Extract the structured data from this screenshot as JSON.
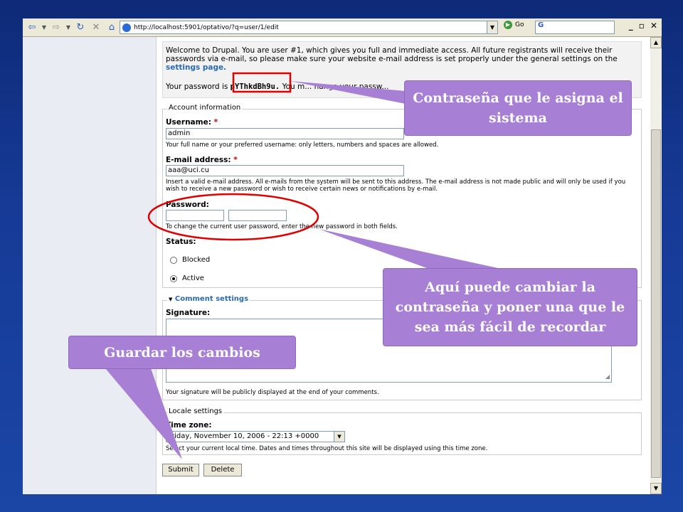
{
  "browser": {
    "address": "http://localhost:5901/optativo/?q=user/1/edit",
    "go_label": "Go",
    "search_glyph": "G"
  },
  "welcome": {
    "text": "Welcome to Drupal. You are user #1, which gives you full and immediate access. All future registrants will receive their passwords via e-mail, so please make sure your website e-mail address is set properly under the general settings on the",
    "link": "settings page.",
    "pw_prefix": "Your password is",
    "password": "pYThkdBh9u.",
    "pw_suffix": "You m... hange your passw..."
  },
  "account": {
    "legend": "Account information",
    "username_label": "Username:",
    "required_mark": "*",
    "username_value": "admin",
    "username_desc": "Your full name or your preferred username: only letters, numbers and spaces are allowed.",
    "email_label": "E-mail address:",
    "email_value": "aaa@uci.cu",
    "email_desc": "Insert a valid e-mail address. All e-mails from the system will be sent to this address. The e-mail address is not made public and will only be used if you wish to receive a new password or wish to receive certain news or notifications by e-mail.",
    "password_label": "Password:",
    "password_desc": "To change the current user password, enter the new password in both fields.",
    "status_label": "Status:",
    "blocked": "Blocked",
    "active": "Active"
  },
  "comment": {
    "legend": "Comment settings",
    "signature_label": "Signature:",
    "signature_desc": "Your signature will be publicly displayed at the end of your comments."
  },
  "locale": {
    "legend": "Locale settings",
    "timezone_label": "Time zone:",
    "timezone_value": "Friday, November 10, 2006 - 22:13 +0000",
    "timezone_desc": "Select your current local time. Dates and times throughout this site will be displayed using this time zone."
  },
  "buttons": {
    "submit": "Submit",
    "delete": "Delete"
  },
  "callouts": {
    "password_assigned": "Contraseña que le asigna el sistema",
    "change_password": "Aquí puede cambiar la contraseña y poner una que le sea más fácil de recordar",
    "save_changes": "Guardar los cambios"
  },
  "colors": {
    "callout": "#a77fd4",
    "highlight": "#e00000",
    "background": "#163a96"
  }
}
